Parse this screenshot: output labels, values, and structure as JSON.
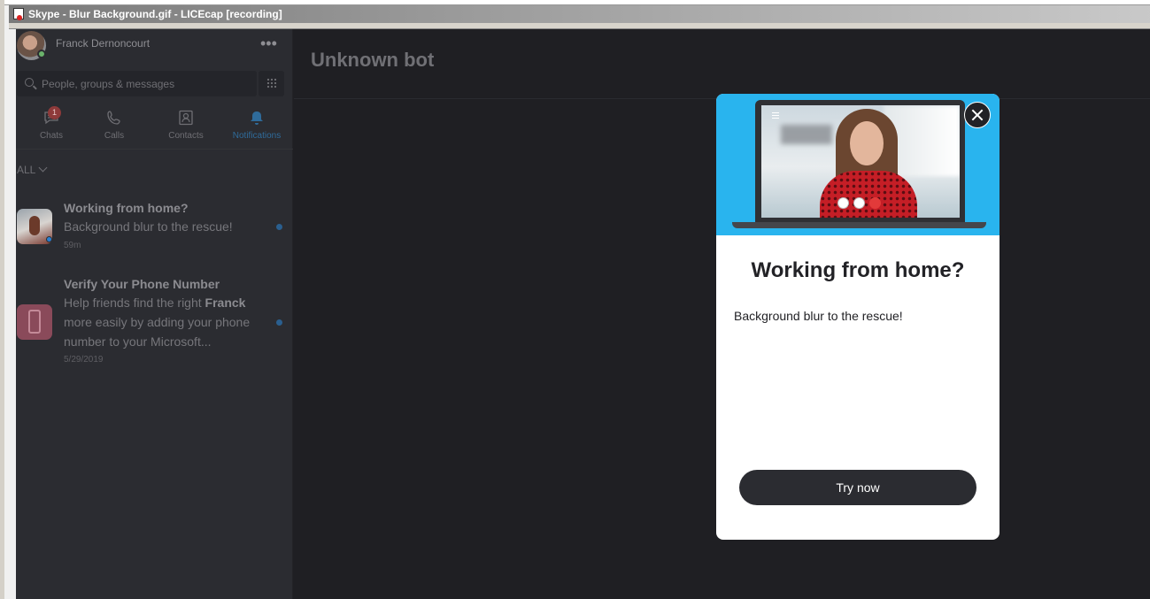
{
  "window": {
    "title": "Skype - Blur Background.gif - LICEcap [recording]"
  },
  "profile": {
    "name": "Franck Dernoncourt",
    "presence": "online"
  },
  "search": {
    "placeholder": "People, groups & messages"
  },
  "tabs": [
    {
      "label": "Chats",
      "icon": "chat-icon",
      "badge": "1",
      "active": false
    },
    {
      "label": "Calls",
      "icon": "phone-icon",
      "active": false
    },
    {
      "label": "Contacts",
      "icon": "contacts-icon",
      "active": false
    },
    {
      "label": "Notifications",
      "icon": "bell-icon",
      "active": true
    }
  ],
  "filter": {
    "label": "ALL"
  },
  "notifications": [
    {
      "title": "Working from home?",
      "body": "Background blur to the rescue!",
      "time": "59m",
      "unread": true
    },
    {
      "title": "Verify Your Phone Number",
      "body_lines": [
        "Help friends find the right ",
        "Franck",
        "more easily by adding your phone",
        "number to your Microsoft..."
      ],
      "time": "5/29/2019",
      "unread": true
    }
  ],
  "main": {
    "title": "Unknown bot"
  },
  "modal": {
    "title": "Working from home?",
    "body": "Background blur to the rescue!",
    "cta": "Try now"
  },
  "colors": {
    "accent": "#29b4ee",
    "sidebar_bg": "#2b2c31",
    "main_bg": "#1f1f23",
    "unread_dot": "#2a5f8f"
  }
}
